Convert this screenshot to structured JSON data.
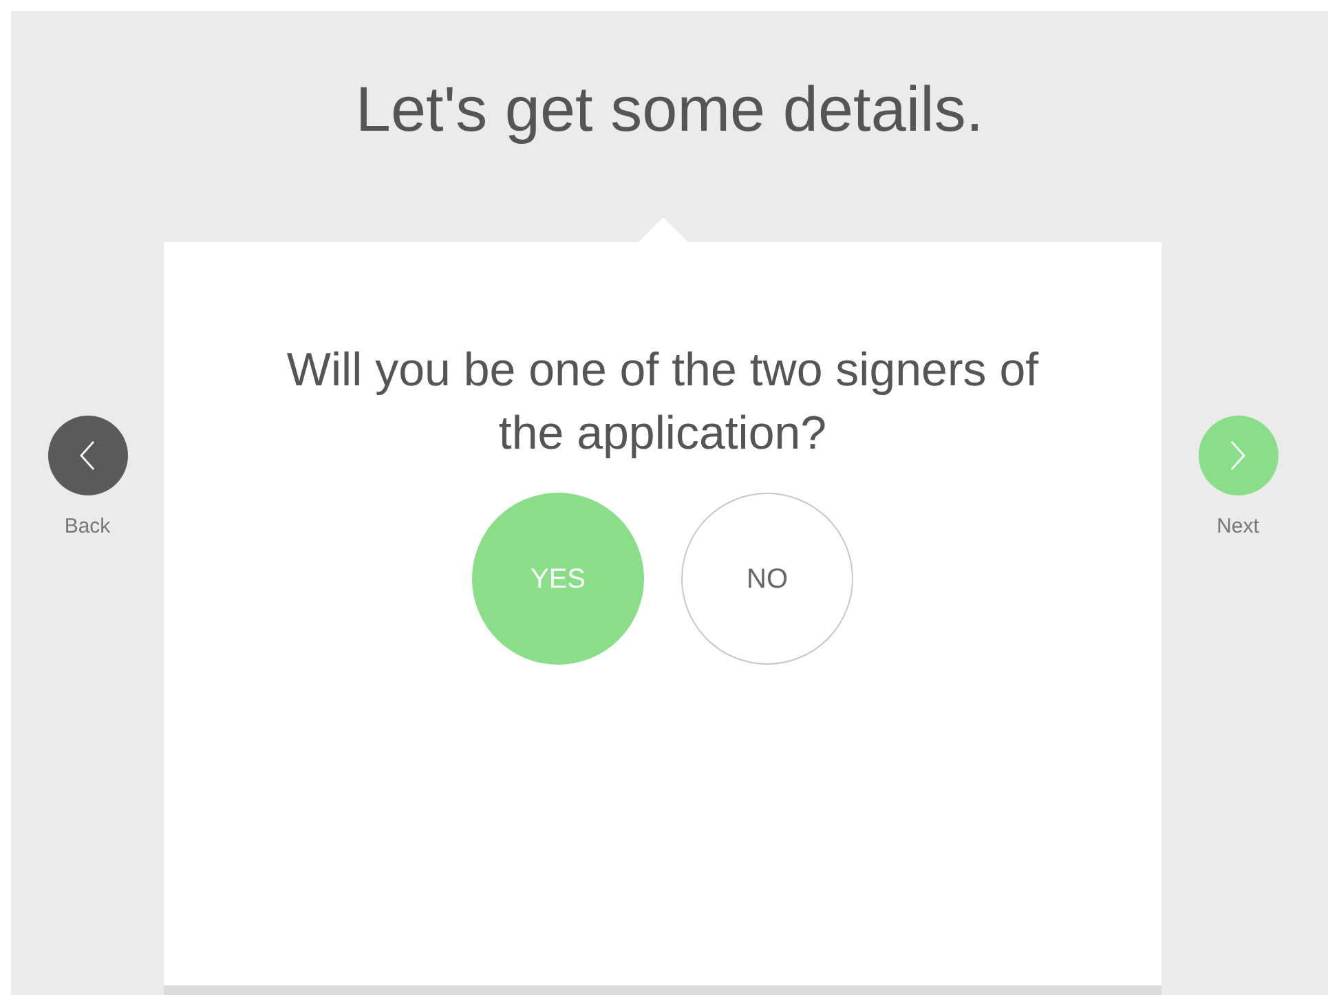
{
  "title": "Let's get some details.",
  "question": "Will you be one of the two signers of the application?",
  "options": [
    {
      "label": "YES",
      "selected": true
    },
    {
      "label": "NO",
      "selected": false
    }
  ],
  "back": {
    "label": "Back"
  },
  "next": {
    "label": "Next"
  }
}
